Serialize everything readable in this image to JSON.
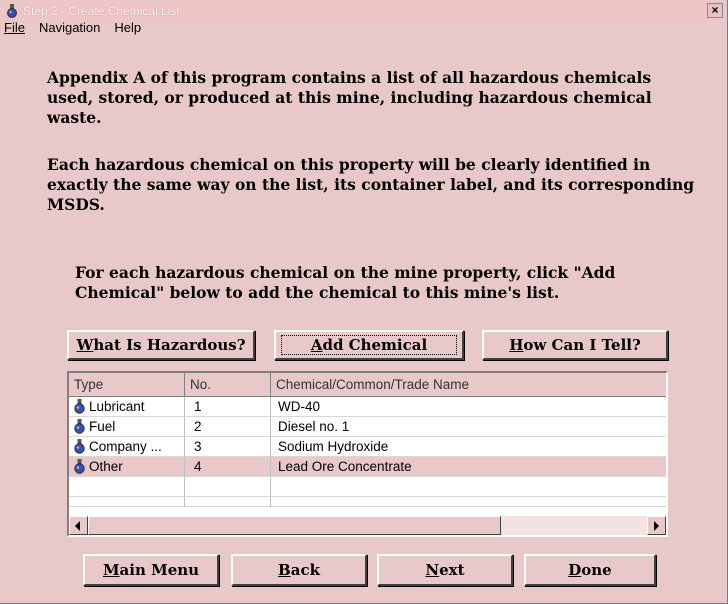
{
  "window": {
    "title": "Step 2 - Create Chemical List",
    "close_glyph": "×"
  },
  "menu": [
    {
      "label": "File"
    },
    {
      "label": "Navigation"
    },
    {
      "label": "Help"
    }
  ],
  "paragraphs": {
    "p1": "Appendix A of this program contains a list of all hazardous chemicals used, stored, or produced at this mine, including hazardous chemical waste.",
    "p2": "Each hazardous chemical on this property will be clearly identified in exactly the same way on the list, its container label, and its corresponding MSDS.",
    "p3": "For each hazardous chemical on the mine property, click \"Add Chemical\" below to add the chemical to this mine's list."
  },
  "buttons": {
    "what": "What Is Hazardous?",
    "add": "Add Chemical",
    "how": "How Can I Tell?",
    "main_menu": "Main Menu",
    "back": "Back",
    "next": "Next",
    "done": "Done"
  },
  "table": {
    "columns": [
      "Type",
      "No.",
      "Chemical/Common/Trade Name"
    ],
    "rows": [
      {
        "type": "Lubricant",
        "no": "1",
        "name": "WD-40",
        "icon": "flask-icon"
      },
      {
        "type": "Fuel",
        "no": "2",
        "name": "Diesel no. 1",
        "icon": "flask-icon"
      },
      {
        "type": "Company ...",
        "no": "3",
        "name": "Sodium Hydroxide",
        "icon": "flask-icon"
      },
      {
        "type": "Other",
        "no": "4",
        "name": "Lead Ore Concentrate",
        "icon": "flask-icon",
        "selected": true
      }
    ]
  },
  "colors": {
    "face": "#e8c8c8",
    "titlebar": "#f0c4c4"
  }
}
